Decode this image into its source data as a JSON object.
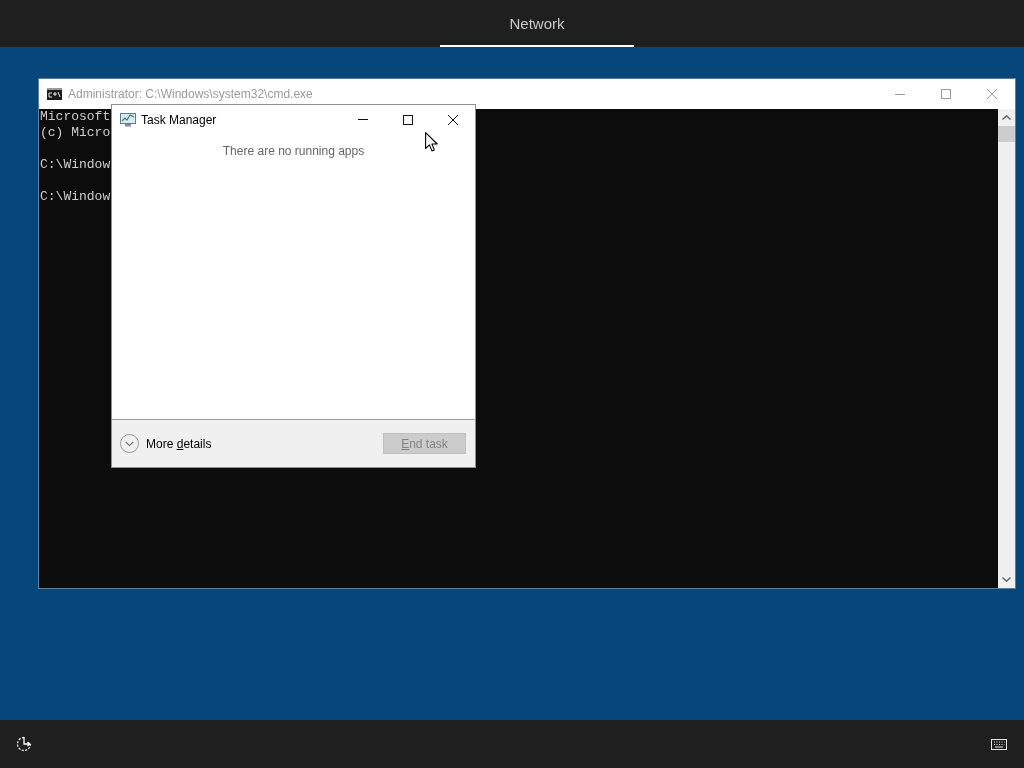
{
  "top_bar": {
    "tabs": [
      {
        "label": "Network",
        "selected": true
      }
    ]
  },
  "cmd_window": {
    "title": "Administrator: C:\\Windows\\system32\\cmd.exe",
    "active": false,
    "console": {
      "paragraphs": [
        {
          "lines": [
            "Microsoft",
            "(c) Micro"
          ]
        },
        {
          "lines": [
            "C:\\Window"
          ]
        },
        {
          "lines": [
            "C:\\Window"
          ]
        }
      ]
    }
  },
  "task_manager": {
    "title": "Task Manager",
    "active": true,
    "message": "There are no running apps",
    "more_details": {
      "label_parts": [
        {
          "text": "More ",
          "access_key": false
        },
        {
          "text": "d",
          "access_key": true
        },
        {
          "text": "etails",
          "access_key": false
        }
      ]
    },
    "end_task": {
      "label_parts": [
        {
          "text": "E",
          "access_key": true
        },
        {
          "text": "nd task",
          "access_key": false
        }
      ],
      "disabled": true
    }
  }
}
